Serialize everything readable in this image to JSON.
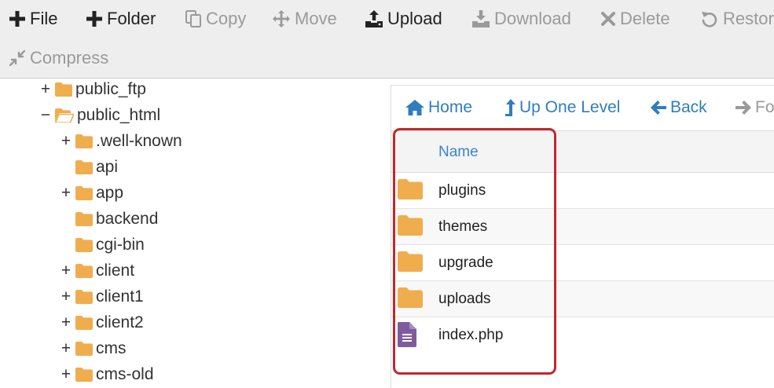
{
  "toolbar": {
    "file": "File",
    "folder": "Folder",
    "copy": "Copy",
    "move": "Move",
    "upload": "Upload",
    "download": "Download",
    "delete": "Delete",
    "restore": "Restore",
    "compress": "Compress"
  },
  "tree": [
    {
      "label": "public_ftp",
      "toggle": "+",
      "icon": "folder-icon"
    },
    {
      "label": "public_html",
      "toggle": "−",
      "icon": "folder-open-icon"
    },
    {
      "label": ".well-known",
      "toggle": "+",
      "icon": "folder-icon"
    },
    {
      "label": "api",
      "toggle": "",
      "icon": "folder-icon"
    },
    {
      "label": "app",
      "toggle": "+",
      "icon": "folder-icon"
    },
    {
      "label": "backend",
      "toggle": "",
      "icon": "folder-icon"
    },
    {
      "label": "cgi-bin",
      "toggle": "",
      "icon": "folder-icon"
    },
    {
      "label": "client",
      "toggle": "+",
      "icon": "folder-icon"
    },
    {
      "label": "client1",
      "toggle": "+",
      "icon": "folder-icon"
    },
    {
      "label": "client2",
      "toggle": "+",
      "icon": "folder-icon"
    },
    {
      "label": "cms",
      "toggle": "+",
      "icon": "folder-icon"
    },
    {
      "label": "cms-old",
      "toggle": "+",
      "icon": "folder-icon"
    }
  ],
  "nav": {
    "home": "Home",
    "up_one_level": "Up One Level",
    "back": "Back",
    "forward": "Fo"
  },
  "table": {
    "name_header": "Name",
    "rows": [
      {
        "name": "plugins",
        "icon": "folder-icon"
      },
      {
        "name": "themes",
        "icon": "folder-icon"
      },
      {
        "name": "upgrade",
        "icon": "folder-icon"
      },
      {
        "name": "uploads",
        "icon": "folder-icon"
      },
      {
        "name": "index.php",
        "icon": "file-text-icon"
      }
    ]
  },
  "colors": {
    "folder": "#f0ad4e",
    "link": "#2f7dc0",
    "php_file": "#7e5c9c",
    "highlight": "#c0282d"
  }
}
